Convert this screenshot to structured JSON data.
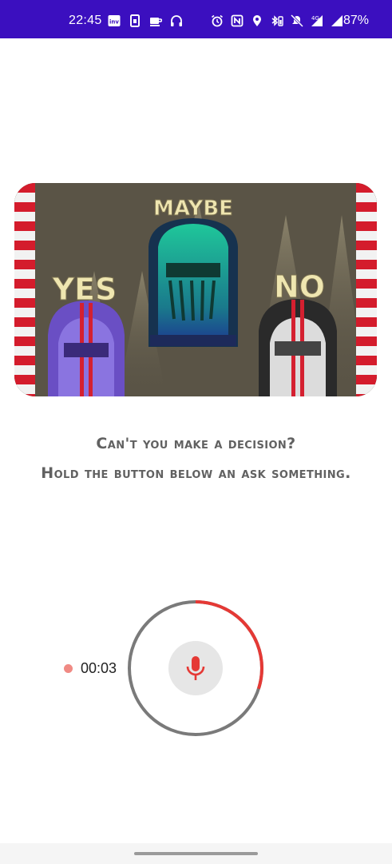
{
  "status_bar": {
    "time": "22:45",
    "left_icons": [
      "inv-app-icon",
      "sim-icon",
      "coffee-icon",
      "headphones-icon"
    ],
    "right_icons": [
      "alarm-icon",
      "nfc-icon",
      "location-icon",
      "bluetooth-battery-icon",
      "mute-icon",
      "signal-4g-icon",
      "signal-icon"
    ],
    "network_label": "4G",
    "battery": "87%",
    "background_color": "#3b0fbf"
  },
  "hero": {
    "label_yes": "YES",
    "label_maybe": "MAYBE",
    "label_no": "NO"
  },
  "prompt": {
    "line1": "Can't you make a decision?",
    "line2": "Hold the button below an ask something."
  },
  "recorder": {
    "timer": "00:03",
    "progress_fraction": 0.3,
    "accent_color": "#e53935"
  }
}
